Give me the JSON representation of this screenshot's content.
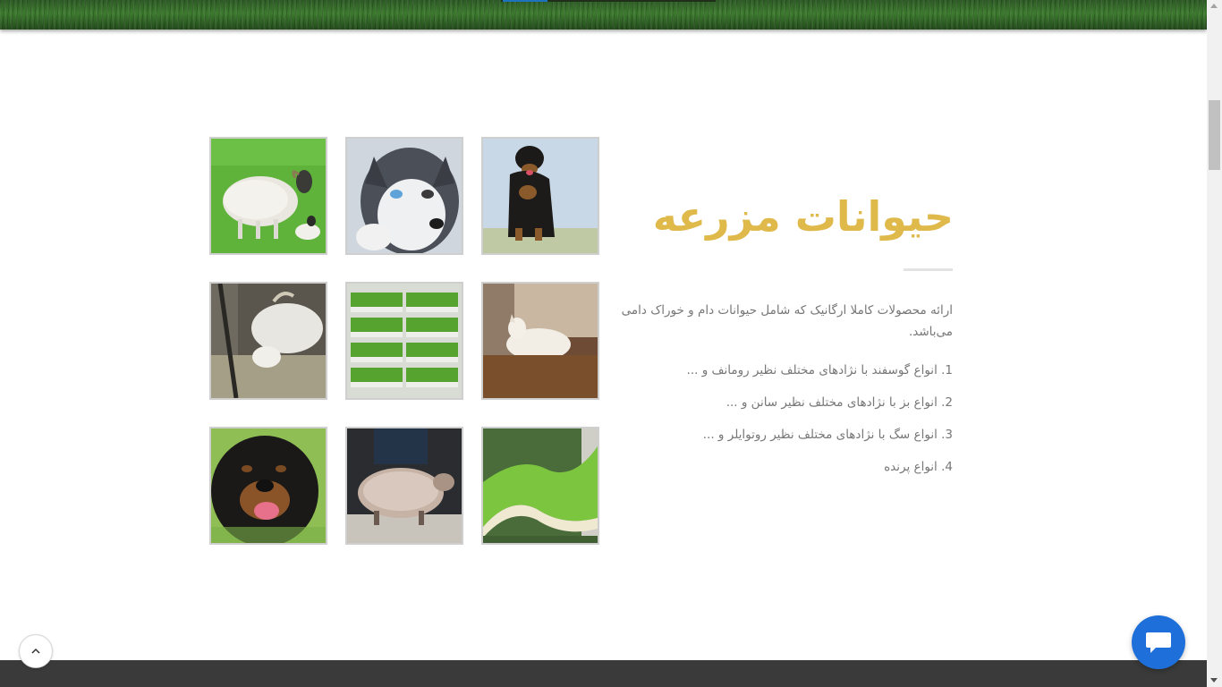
{
  "section": {
    "title": "حیوانات مزرعه",
    "description": "ارائه محصولات کاملا ارگانیک که شامل حیوانات دام و خوراک دامی می‌باشد.",
    "items": [
      "1. انواع گوسفند با نژادهای مختلف نظیر رومانف و ...",
      "2. انواع بز با نژادهای مختلف نظیر سانن و ...",
      "3. انواع سگ با نژادهای مختلف نظیر روتوایلر و ...",
      "4. انواع پرنده"
    ]
  },
  "gallery": [
    {
      "name": "sheep-with-lamb"
    },
    {
      "name": "husky-puppy"
    },
    {
      "name": "rottweiler-sitting"
    },
    {
      "name": "white-goat-eating"
    },
    {
      "name": "hydroponic-fodder-racks"
    },
    {
      "name": "white-goat-lying"
    },
    {
      "name": "rottweiler-portrait"
    },
    {
      "name": "shorn-sheep"
    },
    {
      "name": "fodder-grass-mat"
    }
  ],
  "controls": {
    "back_to_top_icon": "chevron-up-icon",
    "chat_icon": "chat-bubble-icon"
  },
  "colors": {
    "title": "#e0b94b",
    "body_text": "#777777",
    "chat_button": "#1e6fd9",
    "footer": "#3a3a3a"
  }
}
